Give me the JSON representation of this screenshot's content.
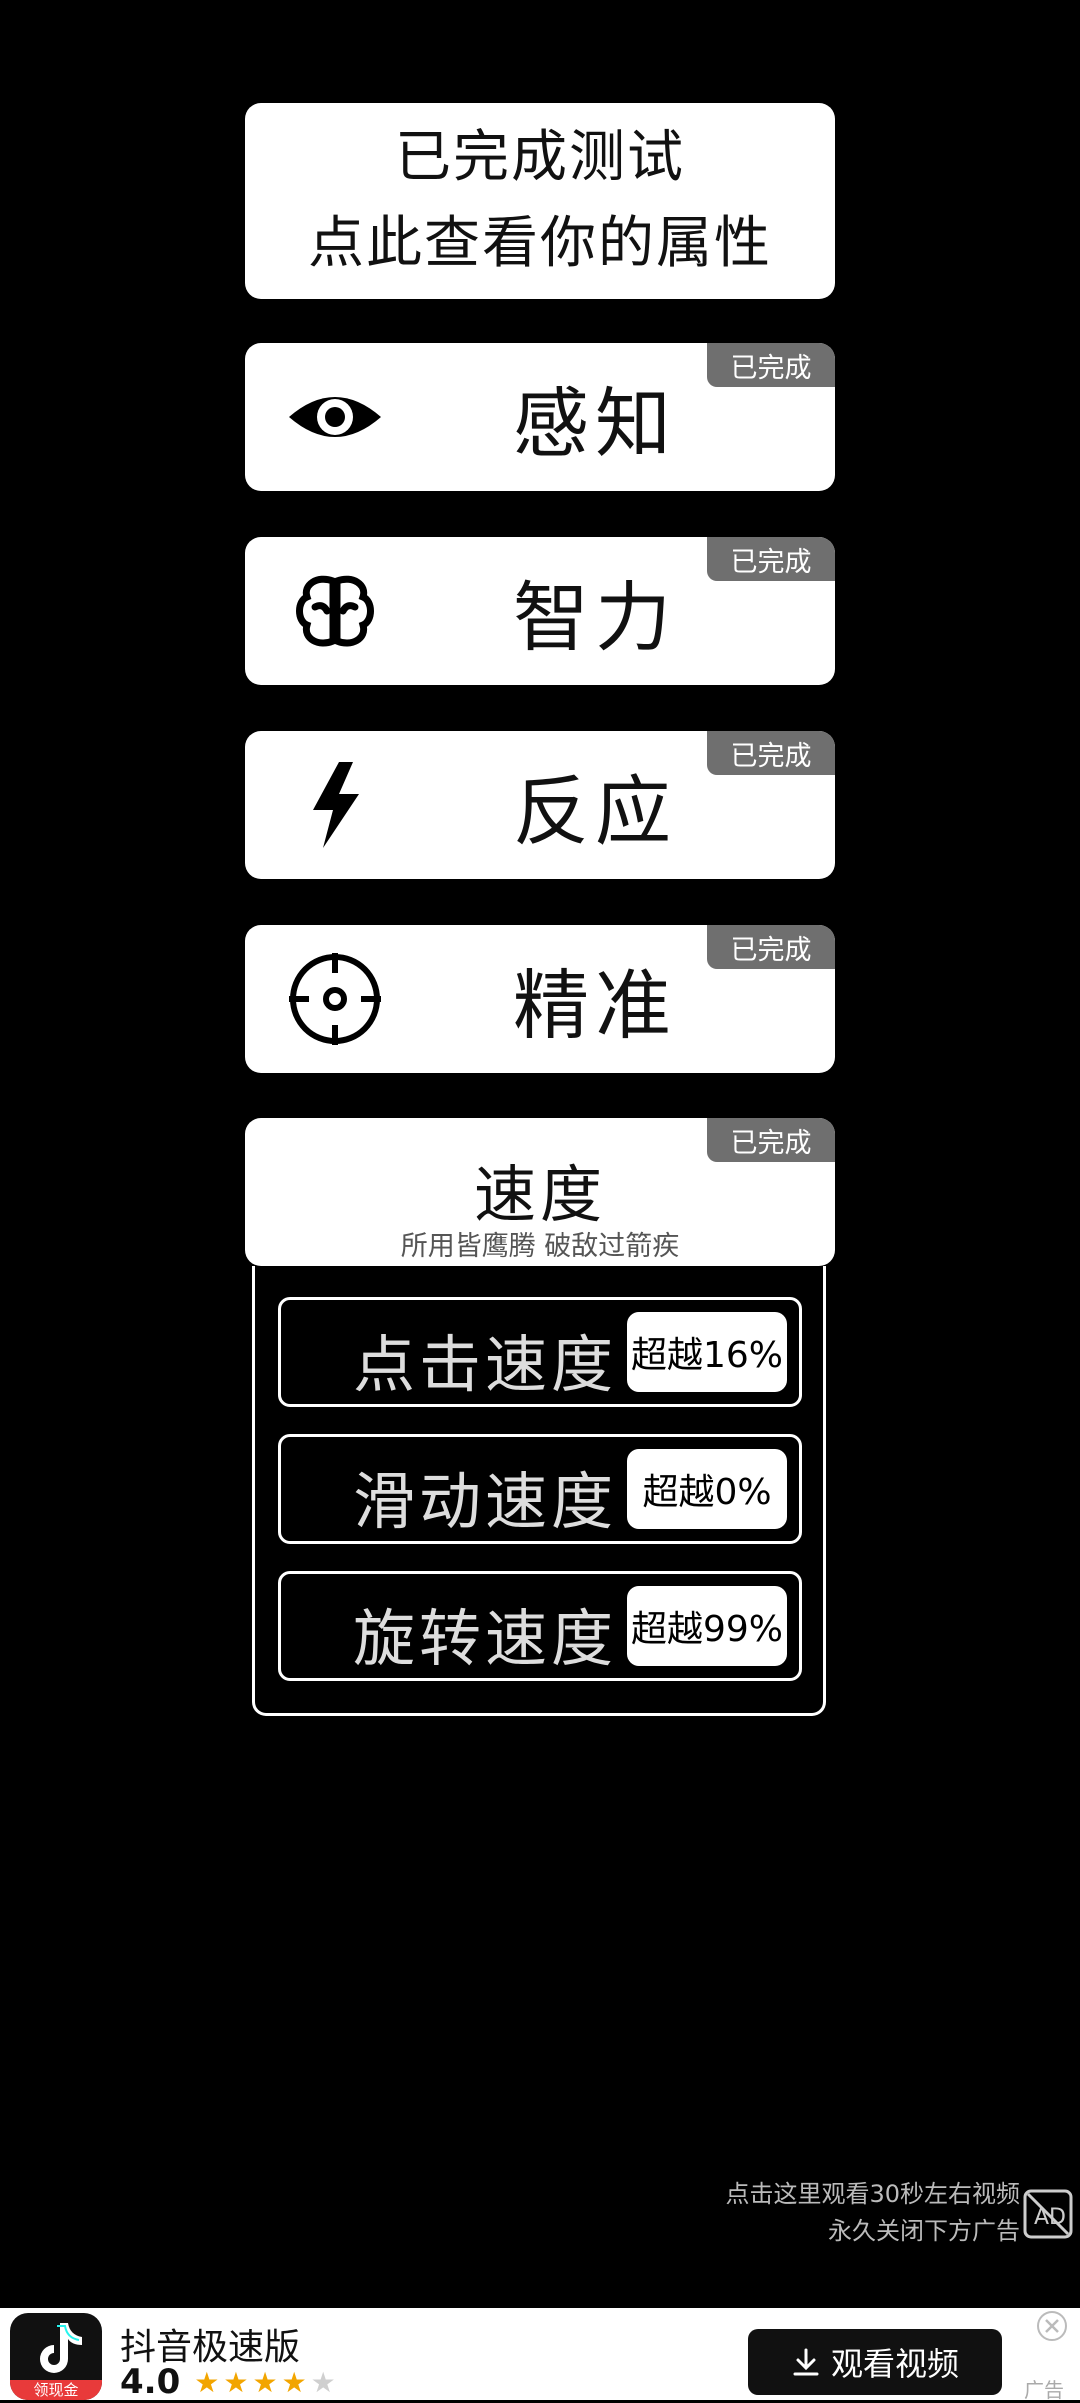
{
  "summary": {
    "line1": "已完成测试",
    "line2": "点此查看你的属性"
  },
  "categories": [
    {
      "name": "感知",
      "status": "已完成",
      "icon": "eye-icon"
    },
    {
      "name": "智力",
      "status": "已完成",
      "icon": "brain-icon"
    },
    {
      "name": "反应",
      "status": "已完成",
      "icon": "lightning-icon"
    },
    {
      "name": "精准",
      "status": "已完成",
      "icon": "crosshair-icon"
    }
  ],
  "speed": {
    "title": "速度",
    "status": "已完成",
    "subtitle": "所用皆鹰腾 破敌过箭疾",
    "metrics": [
      {
        "label": "点击速度",
        "value": "超越16%"
      },
      {
        "label": "滑动速度",
        "value": "超越0%"
      },
      {
        "label": "旋转速度",
        "value": "超越99%"
      }
    ]
  },
  "ad_note": {
    "line1": "点击这里观看30秒左右视频",
    "line2": "永久关闭下方广告"
  },
  "ad": {
    "app_name": "抖音极速版",
    "rating": "4.0",
    "stars_filled": 4,
    "stars_total": 5,
    "cta": "观看视频",
    "logo_caption": "领现金",
    "label": "广告"
  }
}
